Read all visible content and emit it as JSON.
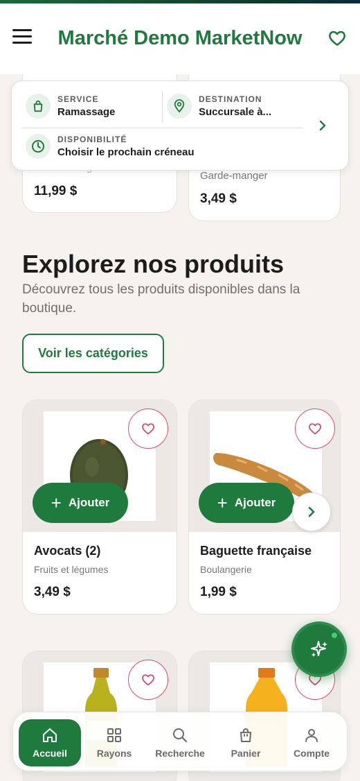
{
  "header": {
    "title": "Marché Demo MarketNow"
  },
  "service": {
    "service_label": "SERVICE",
    "service_value": "Ramassage",
    "destination_label": "DESTINATION",
    "destination_value": "Succursale à...",
    "availability_label": "DISPONIBILITÉ",
    "availability_value": "Choisir le prochain créneau"
  },
  "top_cards": [
    {
      "category": "Garde-manger",
      "price": "11,99 $"
    },
    {
      "category": "Garde-manger",
      "price": "3,49 $"
    }
  ],
  "explore": {
    "title": "Explorez nos produits",
    "subtitle": "Découvrez tous les produits disponibles dans la boutique.",
    "categories_button": "Voir les catégories"
  },
  "products": [
    {
      "name": "Avocats (2)",
      "category": "Fruits et légumes",
      "price": "3,49 $",
      "add_label": "Ajouter"
    },
    {
      "name": "Baguette française",
      "category": "Boulangerie",
      "price": "1,99 $",
      "add_label": "Ajouter"
    }
  ],
  "nav": {
    "items": [
      {
        "label": "Accueil",
        "icon": "home-icon"
      },
      {
        "label": "Rayons",
        "icon": "grid-icon"
      },
      {
        "label": "Recherche",
        "icon": "search-icon"
      },
      {
        "label": "Panier",
        "icon": "bag-icon"
      },
      {
        "label": "Compte",
        "icon": "user-icon"
      }
    ]
  },
  "colors": {
    "brand": "#1f7a3d",
    "favorite": "#d64a6e",
    "background": "#f6f3ef"
  }
}
